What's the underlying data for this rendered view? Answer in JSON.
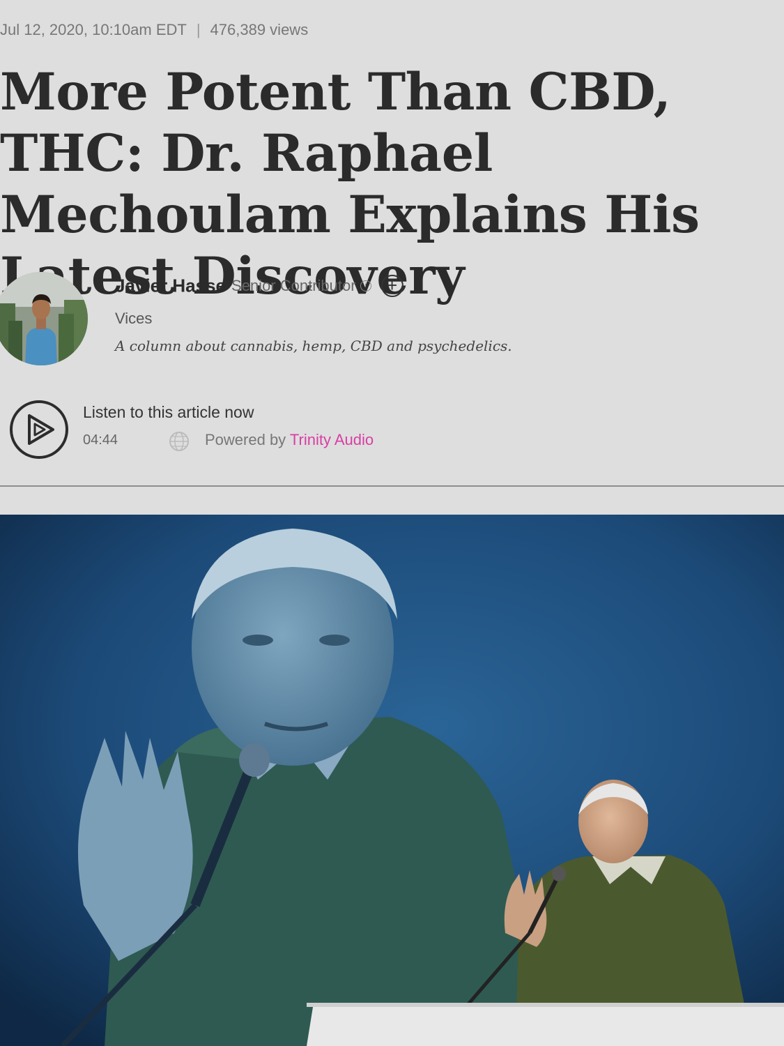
{
  "article": {
    "date": "Jul 12, 2020, 10:10am EDT",
    "separator": "|",
    "views": "476,389 views",
    "title": "More Potent Than CBD, THC: Dr. Raphael Mechoulam Explains His Latest Discovery"
  },
  "author": {
    "name": "Javier Hasse",
    "role": "Senior Contributor",
    "info_icon": "info-icon",
    "follow_icon": "plus-circle-icon",
    "section": "Vices",
    "column_description": "A column about cannabis, hemp, CBD and psychedelics."
  },
  "audio": {
    "listen_label": "Listen to this article now",
    "duration": "04:44",
    "powered_label": "Powered by",
    "brand": "Trinity Audio",
    "play_icon": "play-icon",
    "globe_icon": "globe-icon"
  },
  "colors": {
    "background": "#dedede",
    "brand_pink": "#d83fa5",
    "photo_blue": "#1d4f7e"
  }
}
